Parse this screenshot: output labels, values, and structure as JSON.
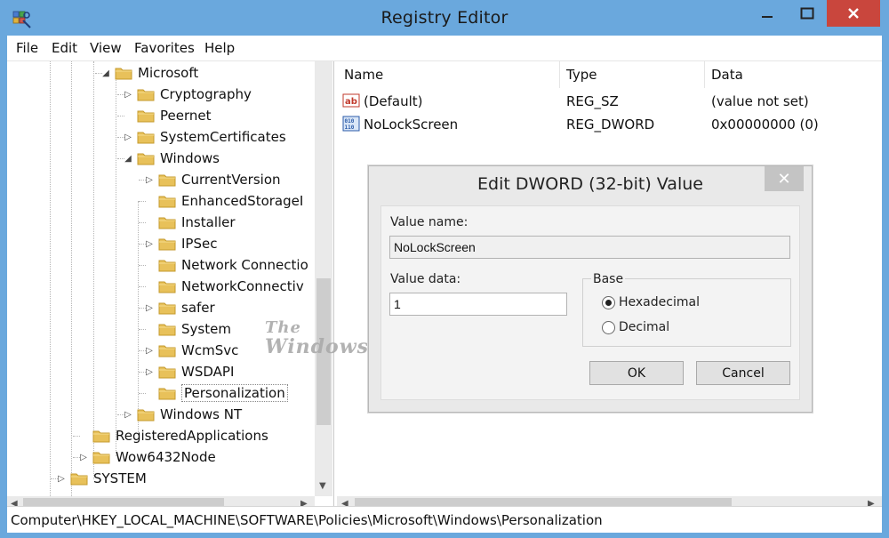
{
  "window": {
    "title": "Registry Editor"
  },
  "menu": [
    "File",
    "Edit",
    "View",
    "Favorites",
    "Help"
  ],
  "tree": [
    {
      "label": "Microsoft",
      "arrow": "◢"
    },
    {
      "label": "Cryptography",
      "arrow": "▷"
    },
    {
      "label": "Peernet",
      "arrow": ""
    },
    {
      "label": "SystemCertificates",
      "arrow": "▷"
    },
    {
      "label": "Windows",
      "arrow": "◢"
    },
    {
      "label": "CurrentVersion",
      "arrow": "▷"
    },
    {
      "label": "EnhancedStorageI",
      "arrow": ""
    },
    {
      "label": "Installer",
      "arrow": ""
    },
    {
      "label": "IPSec",
      "arrow": "▷"
    },
    {
      "label": "Network Connectio",
      "arrow": ""
    },
    {
      "label": "NetworkConnectiv",
      "arrow": ""
    },
    {
      "label": "safer",
      "arrow": "▷"
    },
    {
      "label": "System",
      "arrow": ""
    },
    {
      "label": "WcmSvc",
      "arrow": "▷"
    },
    {
      "label": "WSDAPI",
      "arrow": "▷"
    },
    {
      "label": "Personalization",
      "arrow": ""
    },
    {
      "label": "Windows NT",
      "arrow": "▷"
    },
    {
      "label": "RegisteredApplications",
      "arrow": ""
    },
    {
      "label": "Wow6432Node",
      "arrow": "▷"
    },
    {
      "label": "SYSTEM",
      "arrow": "▷"
    }
  ],
  "list": {
    "columns": [
      "Name",
      "Type",
      "Data"
    ],
    "rows": [
      {
        "name": "(Default)",
        "type": "REG_SZ",
        "data": "(value not set)",
        "icon": "string-value-icon"
      },
      {
        "name": "NoLockScreen",
        "type": "REG_DWORD",
        "data": "0x00000000 (0)",
        "icon": "dword-value-icon"
      }
    ]
  },
  "status": "Computer\\HKEY_LOCAL_MACHINE\\SOFTWARE\\Policies\\Microsoft\\Windows\\Personalization",
  "dialog": {
    "title": "Edit DWORD (32-bit) Value",
    "close": "✕",
    "value_name_label": "Value name:",
    "value_name": "NoLockScreen",
    "value_data_label": "Value data:",
    "value_data": "1",
    "base_label": "Base",
    "hex_label": "Hexadecimal",
    "dec_label": "Decimal",
    "base_selected": "Hexadecimal",
    "ok": "OK",
    "cancel": "Cancel"
  },
  "watermark": {
    "line1": "The",
    "line2": "Windows Club"
  },
  "colors": {
    "titlebar": "#6aa8dd",
    "close": "#c9463d",
    "folder": "#e8c15a"
  }
}
